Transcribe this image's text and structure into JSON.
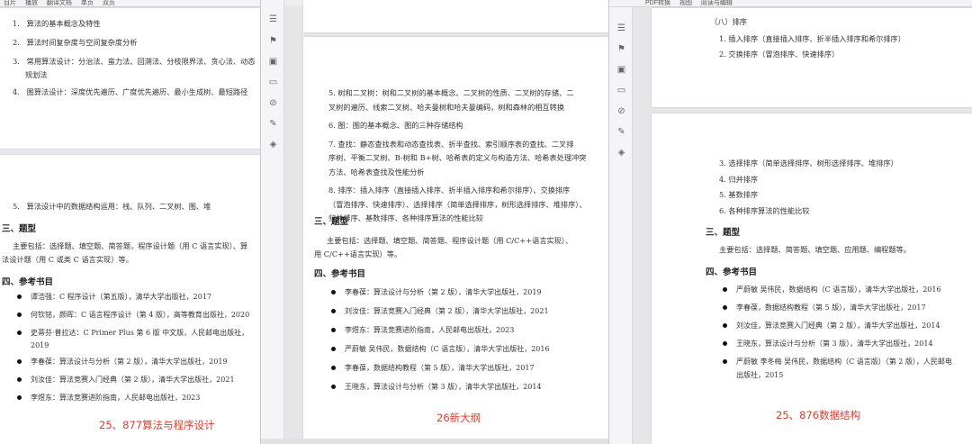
{
  "left_window": {
    "toolbar": [
      "目片",
      "播放",
      "翻译文档",
      "单页",
      "双页"
    ],
    "top_items": [
      {
        "n": "1.",
        "text": "算法的基本概念及特性"
      },
      {
        "n": "2.",
        "text": "算法时间复杂度与空间复杂度分析"
      },
      {
        "n": "3.",
        "text": "常用算法设计：分治法、蛮力法、回溯法、分枝限界法、贪心法、动态",
        "cont": "规划法"
      },
      {
        "n": "4.",
        "text": "图算法设计：深度优先遍历、广度优先遍历、最小生成树、最短路径"
      }
    ],
    "item5": {
      "n": "5.",
      "text": "算法设计中的数据结构运用：栈、队列、二叉树、图、堆"
    },
    "section3": {
      "title": "三、题型",
      "line1": "主要包括：选择题、填空题、简答题，程序设计题（用 C 语言实现）、算",
      "line2": "法设计题（用 C 或类 C 语言实现）等。"
    },
    "section4": {
      "title": "四、参考书目"
    },
    "books": [
      "谭浩强：C 程序设计（第五版），清华大学出版社，2017",
      "何钦铭，颜晖：C 语言程序设计（第 4 版），高等教育出版社，2020",
      "史蒂芬·普拉达：C Primer Plus 第 6 版 中文版，人民邮电出版社，",
      "李春葆：算法设计与分析（第 2 版），清华大学出版社，2019",
      "刘汝佳：算法竞赛入门经典（第 2 版），清华大学出版社，2021",
      "李煜东：算法竞赛进阶指南，人民邮电出版社，2023"
    ],
    "book3_cont": "2019",
    "caption": "25、877算法与程序设计"
  },
  "middle_window": {
    "items": [
      {
        "text": "5.  树和二叉树：树和二叉树的基本概念、二叉树的性质、二叉树的存储、二",
        "cont": "叉树的遍历、线索二叉树、哈夫曼树和哈夫曼编码，树和森林的相互转换"
      },
      {
        "text": "6.  图：图的基本概念、图的三种存储结构"
      },
      {
        "text": "7.  查找：静态查找表和动态查找表、折半查找、索引顺序表的查找、二叉排",
        "cont": "序树、平衡二叉树、B-树和 B+树、哈希表的定义与构造方法、哈希表处理冲突",
        "cont2": "方法、哈希表查找及性能分析"
      },
      {
        "text": "8.  排序：插入排序（直接插入排序、折半插入排序和希尔排序）、交换排序",
        "cont": "（冒泡排序、快速排序）、选择排序（简单选择排序，树形选择排序、堆排序）、",
        "cont2": "归并排序、基数排序、各种排序算法的性能比较"
      }
    ],
    "section3": {
      "title": "三、题型",
      "line1": "主要包括：选择题、填空题、简答题、程序设计题（用 C/C++语言实现）、",
      "line2": "用 C/C++语言实现）等。"
    },
    "section4": {
      "title": "四、参考书目"
    },
    "books": [
      "李春葆：算法设计与分析（第 2 版），清华大学出版社，2019",
      "刘汝佳：算法竞赛入门经典（第 2 版），清华大学出版社，2021",
      "李煜东：算法竞赛进阶指南，人民邮电出版社，2023",
      "严蔚敏  吴伟民，数据结构（C 语言版），清华大学出版社，2016",
      "李春葆，数据结构教程（第 5 版），清华大学出版社，2017",
      "王晓东，算法设计与分析（第 3 版），清华大学出版社，2014"
    ],
    "caption": "26新大纲"
  },
  "right_window": {
    "toolbar": [
      "PDF转换",
      "视图",
      "阅读与编辑"
    ],
    "top": {
      "heading": "（八）排序",
      "l1": "1. 插入排序（直接插入排序、折半插入排序和希尔排序）",
      "l2": "2. 交换排序（冒泡排序、快速排序）"
    },
    "items": [
      "3. 选择排序（简单选择排序、树形选择排序、堆排序）",
      "4. 归并排序",
      "5. 基数排序",
      "6. 各种排序算法的性能比较"
    ],
    "section3": {
      "title": "三、题型",
      "line1": "主要包括：选择题、简答题、填空题、应用题、编程题等。"
    },
    "section4": {
      "title": "四、参考书目"
    },
    "books": [
      "严蔚敏  吴伟民，数据结构（C 语言版），清华大学出版社，2016",
      "李春葆，数据结构教程（第 5 版），清华大学出版社，2017",
      "刘汝佳，算法竞赛入门经典（第 2 版），清华大学出版社，2014",
      "王晓东，算法设计与分析（第 3 版），清华大学出版社，2014",
      "严蔚敏  李冬梅  吴伟民，数据结构（C 语言版）（第 2 版），人民邮电"
    ],
    "book5_cont": "出版社，2015",
    "caption": "25、876数据结构"
  }
}
